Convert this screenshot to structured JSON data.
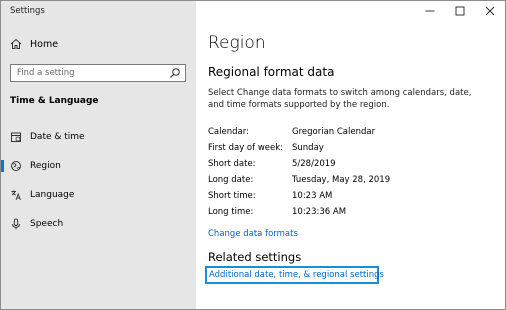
{
  "window": {
    "app_title": "Settings",
    "controls": {
      "minimize": "minimize",
      "maximize": "maximize",
      "close": "close"
    }
  },
  "sidebar": {
    "home_label": "Home",
    "search_placeholder": "Find a setting",
    "section_title": "Time & Language",
    "items": [
      {
        "label": "Date & time",
        "icon": "calendar-icon",
        "active": false
      },
      {
        "label": "Region",
        "icon": "globe-icon",
        "active": true
      },
      {
        "label": "Language",
        "icon": "language-icon",
        "active": false
      },
      {
        "label": "Speech",
        "icon": "microphone-icon",
        "active": false
      }
    ]
  },
  "main": {
    "title": "Region",
    "subtitle": "Regional format data",
    "description": "Select Change data formats to switch among calendars, date, and time formats supported by the region.",
    "formats": [
      {
        "key": "Calendar:",
        "value": "Gregorian Calendar"
      },
      {
        "key": "First day of week:",
        "value": "Sunday"
      },
      {
        "key": "Short date:",
        "value": "5/28/2019"
      },
      {
        "key": "Long date:",
        "value": "Tuesday, May 28, 2019"
      },
      {
        "key": "Short time:",
        "value": "10:23 AM"
      },
      {
        "key": "Long time:",
        "value": "10:23:36 AM"
      }
    ],
    "change_link": "Change data formats",
    "related_title": "Related settings",
    "related_link": "Additional date, time, & regional settings"
  },
  "colors": {
    "accent": "#0078d7",
    "link": "#0066cc",
    "focus_border": "#1a8fd8",
    "sidebar_bg": "#e6e6e6"
  }
}
